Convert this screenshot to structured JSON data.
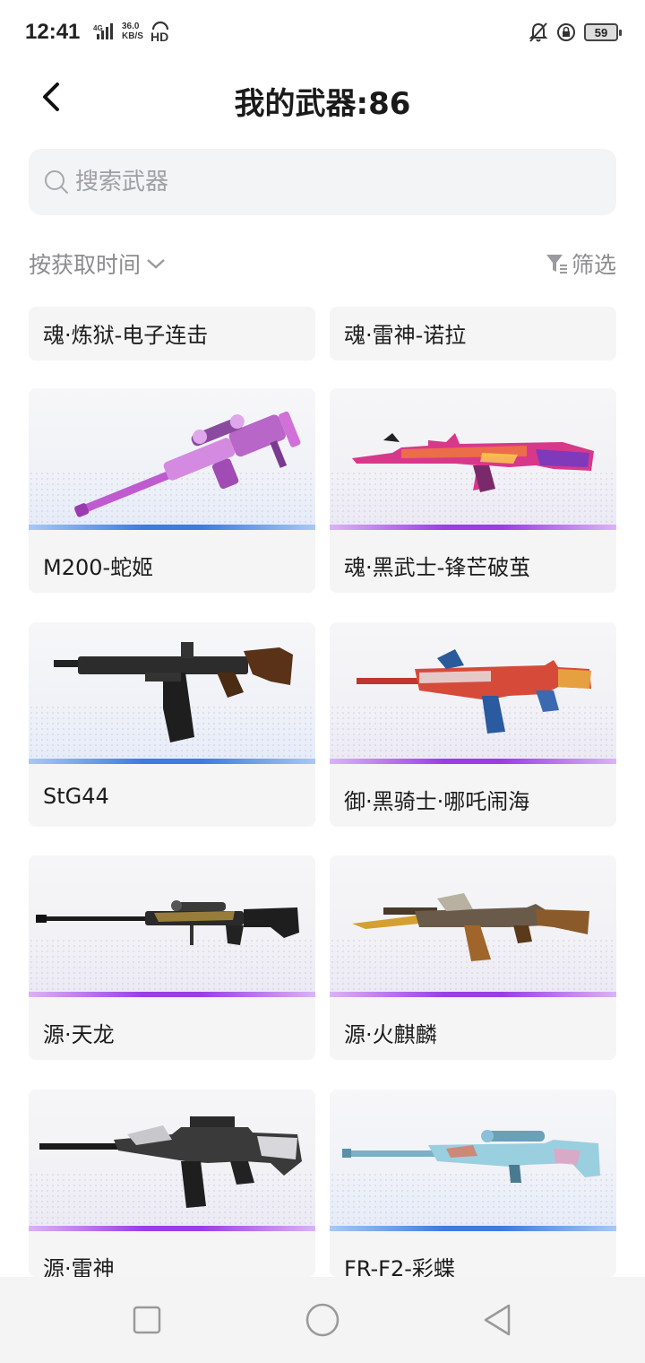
{
  "status_bar": {
    "time": "12:41",
    "network": "4G",
    "speed_value": "36.0",
    "speed_unit": "KB/S",
    "hd": "HD",
    "battery": "59"
  },
  "header": {
    "title": "我的武器:86"
  },
  "search": {
    "placeholder": "搜索武器"
  },
  "sort": {
    "label": "按获取时间",
    "filter_label": "筛选"
  },
  "weapons": [
    {
      "name": "魂·炼狱-电子连击",
      "strip": "purple"
    },
    {
      "name": "魂·雷神-诺拉",
      "strip": "purple"
    },
    {
      "name": "M200-蛇姬",
      "strip": "blue",
      "icon": "sniper-rifle-pink-icon"
    },
    {
      "name": "魂·黑武士-锋芒破茧",
      "strip": "purple",
      "icon": "assault-rifle-neon-icon"
    },
    {
      "name": "StG44",
      "strip": "blue",
      "icon": "assault-rifle-black-icon"
    },
    {
      "name": "御·黑骑士·哪吒闹海",
      "strip": "purple",
      "icon": "carbine-red-dragon-icon"
    },
    {
      "name": "源·天龙",
      "strip": "purple",
      "icon": "sniper-rifle-dragon-icon"
    },
    {
      "name": "源·火麒麟",
      "strip": "purple",
      "icon": "ak-gold-icon"
    },
    {
      "name": "源·雷神",
      "strip": "purple",
      "icon": "m4-silver-icon"
    },
    {
      "name": "FR-F2-彩蝶",
      "strip": "blue",
      "icon": "sniper-rifle-butterfly-icon"
    }
  ],
  "nav": {
    "recent_icon": "square-icon",
    "home_icon": "circle-icon",
    "back_icon": "triangle-back-icon"
  }
}
